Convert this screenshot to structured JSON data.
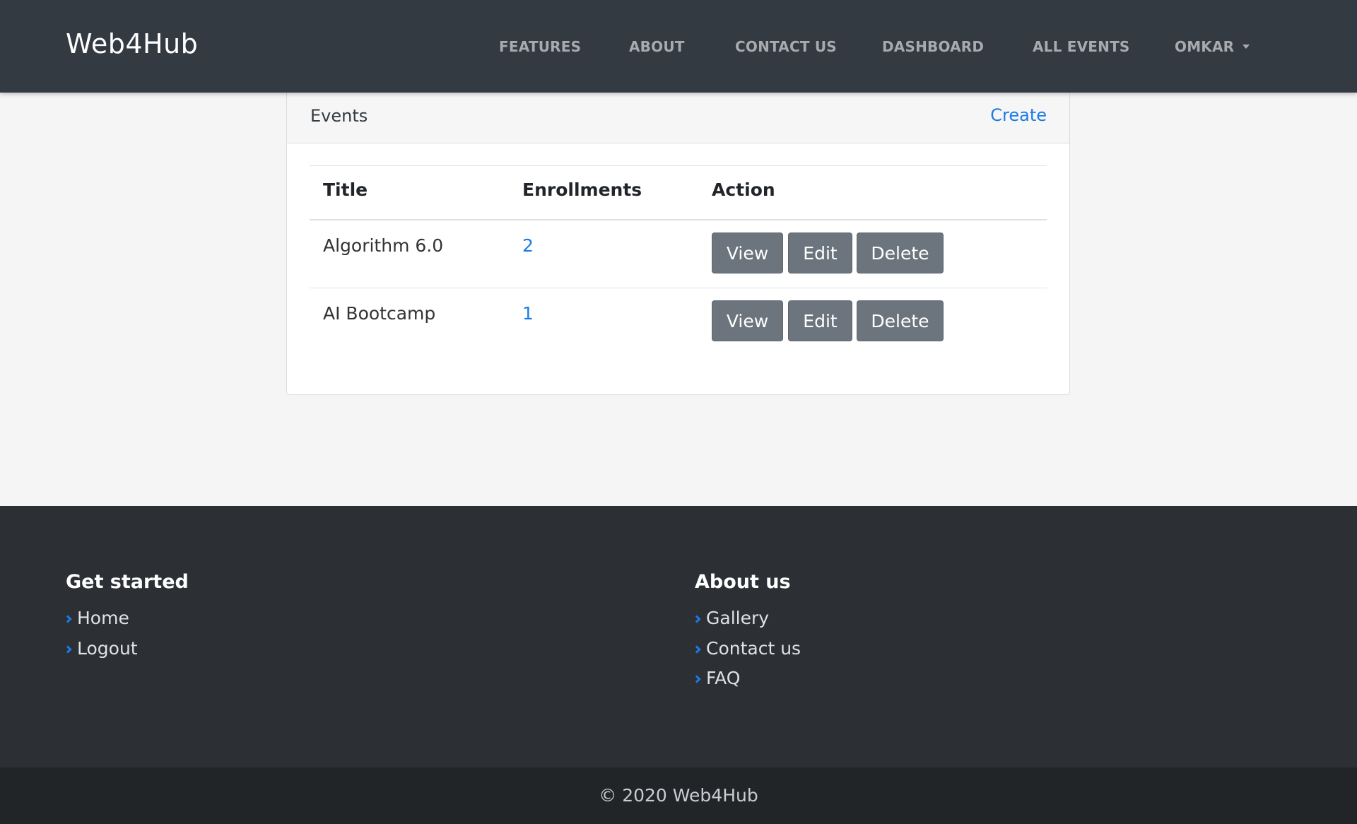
{
  "navbar": {
    "brand": "Web4Hub",
    "links": [
      "FEATURES",
      "ABOUT",
      "CONTACT US",
      "DASHBOARD",
      "ALL EVENTS"
    ],
    "user": "OMKAR"
  },
  "events_card": {
    "title": "Events",
    "create_label": "Create",
    "columns": [
      "Title",
      "Enrollments",
      "Action"
    ],
    "rows": [
      {
        "title": "Algorithm 6.0",
        "enrollments": "2"
      },
      {
        "title": "AI Bootcamp",
        "enrollments": "1"
      }
    ],
    "actions": {
      "view": "View",
      "edit": "Edit",
      "delete": "Delete"
    }
  },
  "footer": {
    "get_started": {
      "title": "Get started",
      "links": [
        "Home",
        "Logout"
      ]
    },
    "about_us": {
      "title": "About us",
      "links": [
        "Gallery",
        "Contact us",
        "FAQ"
      ]
    },
    "copyright": "© 2020 Web4Hub"
  }
}
